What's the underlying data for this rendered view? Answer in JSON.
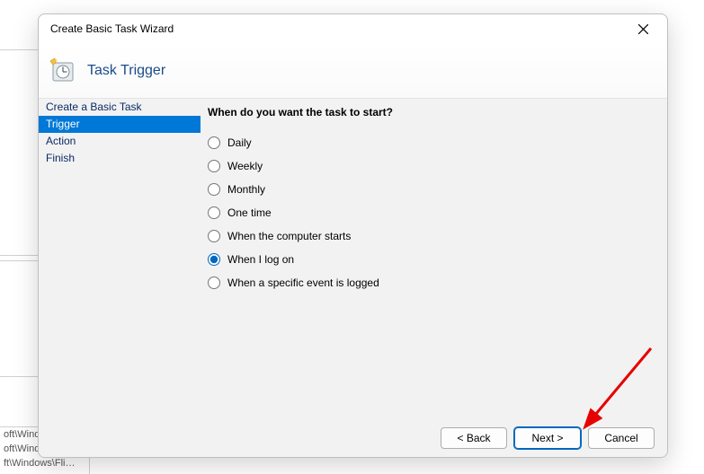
{
  "background_fragments": {
    "line1": "oft\\Wind…",
    "line2": "oft\\Windows\\O…",
    "line3": "ft\\Windows\\Fli…"
  },
  "dialog": {
    "title": "Create Basic Task Wizard",
    "header": "Task Trigger",
    "steps": [
      {
        "label": "Create a Basic Task",
        "selected": false
      },
      {
        "label": "Trigger",
        "selected": true
      },
      {
        "label": "Action",
        "selected": false
      },
      {
        "label": "Finish",
        "selected": false
      }
    ],
    "content": {
      "heading": "When do you want the task to start?",
      "options": [
        {
          "label": "Daily",
          "checked": false
        },
        {
          "label": "Weekly",
          "checked": false
        },
        {
          "label": "Monthly",
          "checked": false
        },
        {
          "label": "One time",
          "checked": false
        },
        {
          "label": "When the computer starts",
          "checked": false
        },
        {
          "label": "When I log on",
          "checked": true
        },
        {
          "label": "When a specific event is logged",
          "checked": false
        }
      ]
    },
    "buttons": {
      "back": "< Back",
      "next": "Next >",
      "cancel": "Cancel"
    }
  }
}
